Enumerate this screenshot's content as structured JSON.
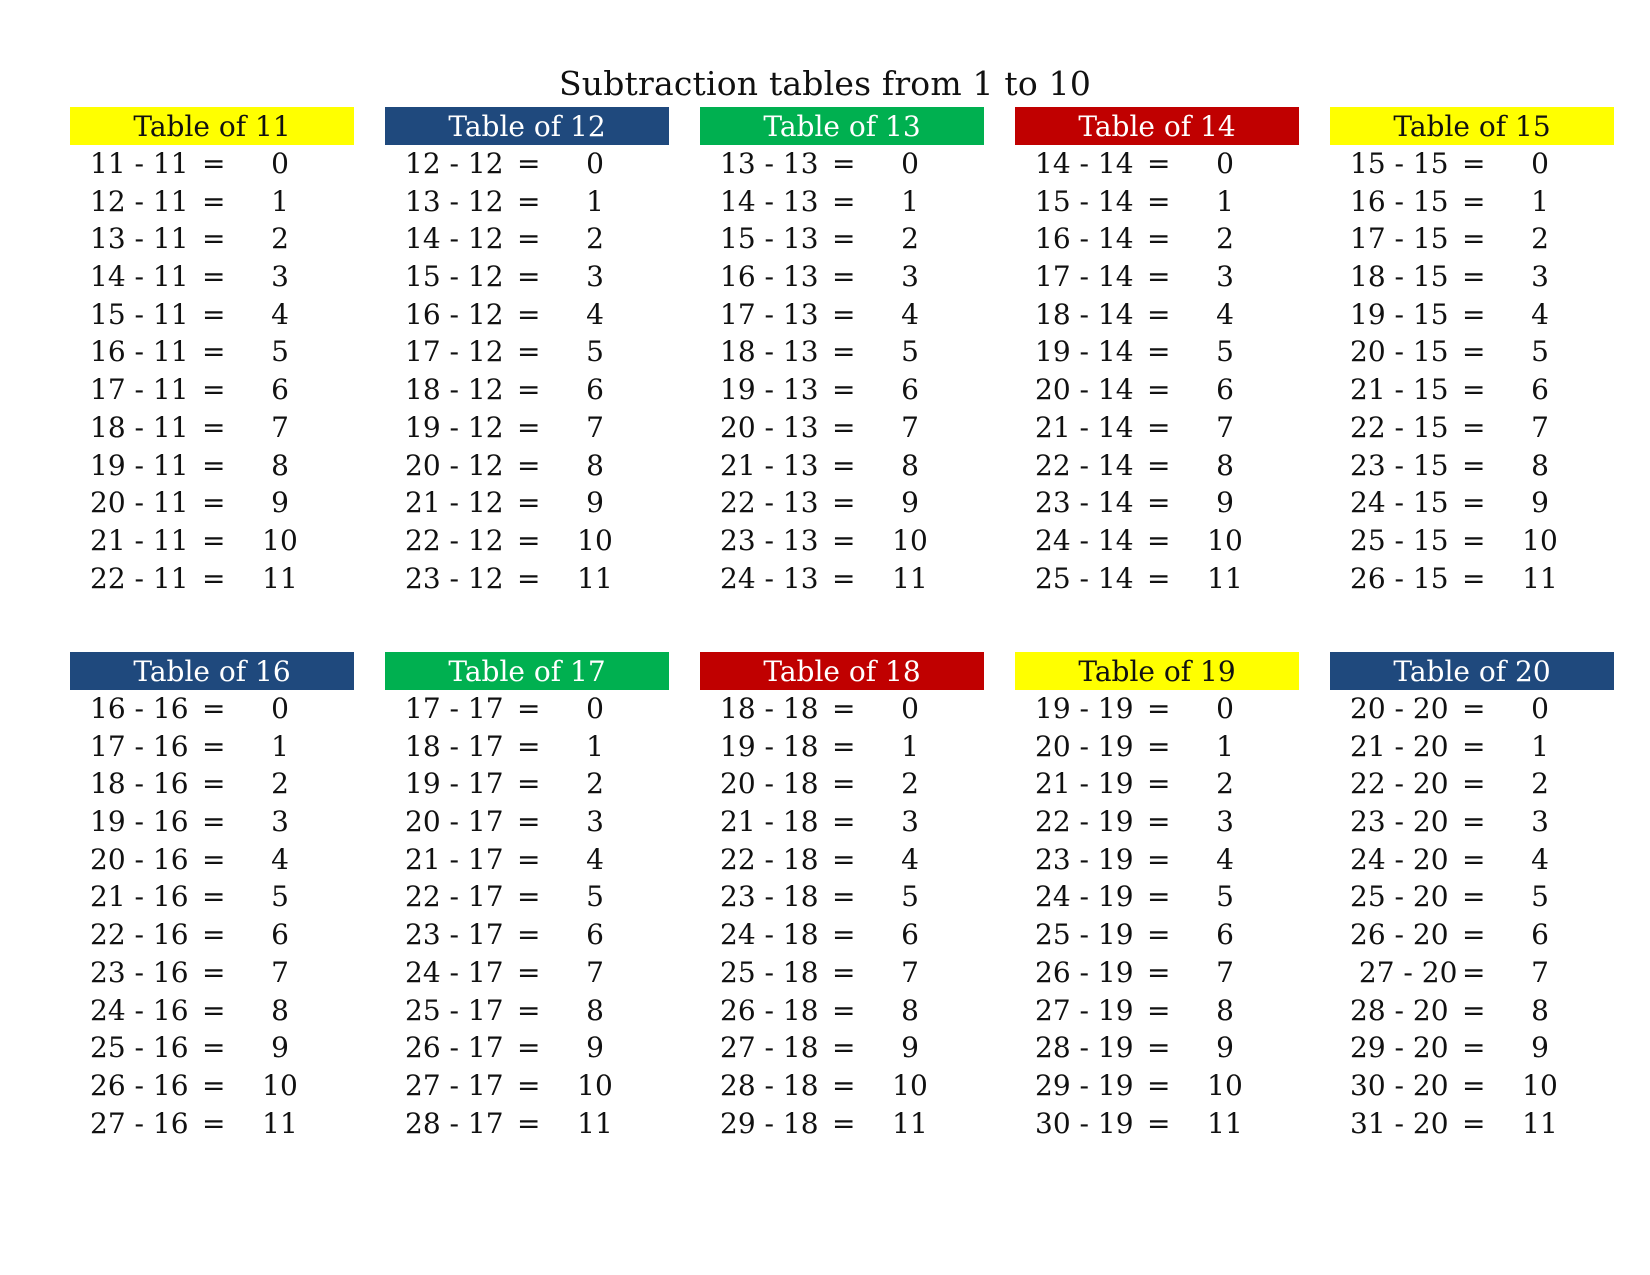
{
  "page": {
    "title": "Subtraction tables from 1 to 10"
  },
  "colors": {
    "yellow": "#FFFF00",
    "navy": "#1F497D",
    "green": "#00B050",
    "red": "#C00000"
  },
  "tables": [
    {
      "header": "Table of 11",
      "header_bg": "#FFFF00",
      "header_fg": "#111111",
      "rows": [
        [
          "11 - 11",
          "=",
          "0"
        ],
        [
          "12 - 11",
          "=",
          "1"
        ],
        [
          "13 - 11",
          "=",
          "2"
        ],
        [
          "14 - 11",
          "=",
          "3"
        ],
        [
          "15 - 11",
          "=",
          "4"
        ],
        [
          "16 - 11",
          "=",
          "5"
        ],
        [
          "17 - 11",
          "=",
          "6"
        ],
        [
          "18 - 11",
          "=",
          "7"
        ],
        [
          "19 - 11",
          "=",
          "8"
        ],
        [
          "20 - 11",
          "=",
          "9"
        ],
        [
          "21 - 11",
          "=",
          "10"
        ],
        [
          "22 - 11",
          "=",
          "11"
        ]
      ]
    },
    {
      "header": "Table of 12",
      "header_bg": "#1F497D",
      "header_fg": "#FFFFFF",
      "rows": [
        [
          "12 - 12",
          "=",
          "0"
        ],
        [
          "13 - 12",
          "=",
          "1"
        ],
        [
          "14 - 12",
          "=",
          "2"
        ],
        [
          "15 - 12",
          "=",
          "3"
        ],
        [
          "16 - 12",
          "=",
          "4"
        ],
        [
          "17 - 12",
          "=",
          "5"
        ],
        [
          "18 - 12",
          "=",
          "6"
        ],
        [
          "19 - 12",
          "=",
          "7"
        ],
        [
          "20 - 12",
          "=",
          "8"
        ],
        [
          "21 - 12",
          "=",
          "9"
        ],
        [
          "22 - 12",
          "=",
          "10"
        ],
        [
          "23 - 12",
          "=",
          "11"
        ]
      ]
    },
    {
      "header": "Table of 13",
      "header_bg": "#00B050",
      "header_fg": "#FFFFFF",
      "rows": [
        [
          "13 - 13",
          "=",
          "0"
        ],
        [
          "14 - 13",
          "=",
          "1"
        ],
        [
          "15 - 13",
          "=",
          "2"
        ],
        [
          "16 - 13",
          "=",
          "3"
        ],
        [
          "17 - 13",
          "=",
          "4"
        ],
        [
          "18 - 13",
          "=",
          "5"
        ],
        [
          "19 - 13",
          "=",
          "6"
        ],
        [
          "20 - 13",
          "=",
          "7"
        ],
        [
          "21 - 13",
          "=",
          "8"
        ],
        [
          "22 - 13",
          "=",
          "9"
        ],
        [
          "23 - 13",
          "=",
          "10"
        ],
        [
          "24 - 13",
          "=",
          "11"
        ]
      ]
    },
    {
      "header": "Table of  14",
      "header_bg": "#C00000",
      "header_fg": "#FFFFFF",
      "rows": [
        [
          "14 - 14",
          "=",
          "0"
        ],
        [
          "15 - 14",
          "=",
          "1"
        ],
        [
          "16 - 14",
          "=",
          "2"
        ],
        [
          "17 - 14",
          "=",
          "3"
        ],
        [
          "18 - 14",
          "=",
          "4"
        ],
        [
          "19 - 14",
          "=",
          "5"
        ],
        [
          "20 - 14",
          "=",
          "6"
        ],
        [
          "21 - 14",
          "=",
          "7"
        ],
        [
          "22 - 14",
          "=",
          "8"
        ],
        [
          "23 - 14",
          "=",
          "9"
        ],
        [
          "24 - 14",
          "=",
          "10"
        ],
        [
          "25 - 14",
          "=",
          "11"
        ]
      ]
    },
    {
      "header": "Table of  15",
      "header_bg": "#FFFF00",
      "header_fg": "#111111",
      "rows": [
        [
          "15 - 15",
          "=",
          "0"
        ],
        [
          "16 - 15",
          "=",
          "1"
        ],
        [
          "17 - 15",
          "=",
          "2"
        ],
        [
          "18 - 15",
          "=",
          "3"
        ],
        [
          "19 - 15",
          "=",
          "4"
        ],
        [
          "20 - 15",
          "=",
          "5"
        ],
        [
          "21 - 15",
          "=",
          "6"
        ],
        [
          "22 - 15",
          "=",
          "7"
        ],
        [
          "23 - 15",
          "=",
          "8"
        ],
        [
          "24 - 15",
          "=",
          "9"
        ],
        [
          "25 - 15",
          "=",
          "10"
        ],
        [
          "26 - 15",
          "=",
          "11"
        ]
      ]
    },
    {
      "header": "Table of 16",
      "header_bg": "#1F497D",
      "header_fg": "#FFFFFF",
      "rows": [
        [
          "16 - 16",
          "=",
          "0"
        ],
        [
          "17 - 16",
          "=",
          "1"
        ],
        [
          "18 - 16",
          "=",
          "2"
        ],
        [
          "19 - 16",
          "=",
          "3"
        ],
        [
          "20 - 16",
          "=",
          "4"
        ],
        [
          "21 - 16",
          "=",
          "5"
        ],
        [
          "22 - 16",
          "=",
          "6"
        ],
        [
          "23 - 16",
          "=",
          "7"
        ],
        [
          "24 - 16",
          "=",
          "8"
        ],
        [
          "25 - 16",
          "=",
          "9"
        ],
        [
          "26 - 16",
          "=",
          "10"
        ],
        [
          "27 - 16",
          "=",
          "11"
        ]
      ]
    },
    {
      "header": "Table of 17",
      "header_bg": "#00B050",
      "header_fg": "#FFFFFF",
      "rows": [
        [
          "17 - 17",
          "=",
          "0"
        ],
        [
          "18 - 17",
          "=",
          "1"
        ],
        [
          "19 - 17",
          "=",
          "2"
        ],
        [
          "20 - 17",
          "=",
          "3"
        ],
        [
          "21 - 17",
          "=",
          "4"
        ],
        [
          "22 - 17",
          "=",
          "5"
        ],
        [
          "23 - 17",
          "=",
          "6"
        ],
        [
          "24 - 17",
          "=",
          "7"
        ],
        [
          "25 - 17",
          "=",
          "8"
        ],
        [
          "26 - 17",
          "=",
          "9"
        ],
        [
          "27 - 17",
          "=",
          "10"
        ],
        [
          "28 - 17",
          "=",
          "11"
        ]
      ]
    },
    {
      "header": "Table of  18",
      "header_bg": "#C00000",
      "header_fg": "#FFFFFF",
      "rows": [
        [
          "18 - 18",
          "=",
          "0"
        ],
        [
          "19 - 18",
          "=",
          "1"
        ],
        [
          "20 - 18",
          "=",
          "2"
        ],
        [
          "21 - 18",
          "=",
          "3"
        ],
        [
          "22 - 18",
          "=",
          "4"
        ],
        [
          "23 - 18",
          "=",
          "5"
        ],
        [
          "24 - 18",
          "=",
          "6"
        ],
        [
          "25 - 18",
          "=",
          "7"
        ],
        [
          "26 - 18",
          "=",
          "8"
        ],
        [
          "27 - 18",
          "=",
          "9"
        ],
        [
          "28 - 18",
          "=",
          "10"
        ],
        [
          "29 - 18",
          "=",
          "11"
        ]
      ]
    },
    {
      "header": "Table of 19",
      "header_bg": "#FFFF00",
      "header_fg": "#111111",
      "rows": [
        [
          "19 - 19",
          "=",
          "0"
        ],
        [
          "20 - 19",
          "=",
          "1"
        ],
        [
          "21 - 19",
          "=",
          "2"
        ],
        [
          "22 - 19",
          "=",
          "3"
        ],
        [
          "23 - 19",
          "=",
          "4"
        ],
        [
          "24 - 19",
          "=",
          "5"
        ],
        [
          "25 - 19",
          "=",
          "6"
        ],
        [
          "26 - 19",
          "=",
          "7"
        ],
        [
          "27 - 19",
          "=",
          "8"
        ],
        [
          "28 - 19",
          "=",
          "9"
        ],
        [
          "29 - 19",
          "=",
          "10"
        ],
        [
          "30 - 19",
          "=",
          "11"
        ]
      ]
    },
    {
      "header": "Table of 20",
      "header_bg": "#1F497D",
      "header_fg": "#FFFFFF",
      "rows": [
        [
          "20 - 20",
          "=",
          "0"
        ],
        [
          "21 - 20",
          "=",
          "1"
        ],
        [
          "22 - 20",
          "=",
          "2"
        ],
        [
          "23 - 20",
          "=",
          "3"
        ],
        [
          "24 - 20",
          "=",
          "4"
        ],
        [
          "25 - 20",
          "=",
          "5"
        ],
        [
          "26 - 20",
          "=",
          "6"
        ],
        [
          " 27 - 20",
          "=",
          "7"
        ],
        [
          "28 - 20",
          "=",
          "8"
        ],
        [
          "29 - 20",
          "=",
          "9"
        ],
        [
          "30 - 20",
          "=",
          "10"
        ],
        [
          "31 - 20",
          "=",
          "11"
        ]
      ]
    }
  ]
}
